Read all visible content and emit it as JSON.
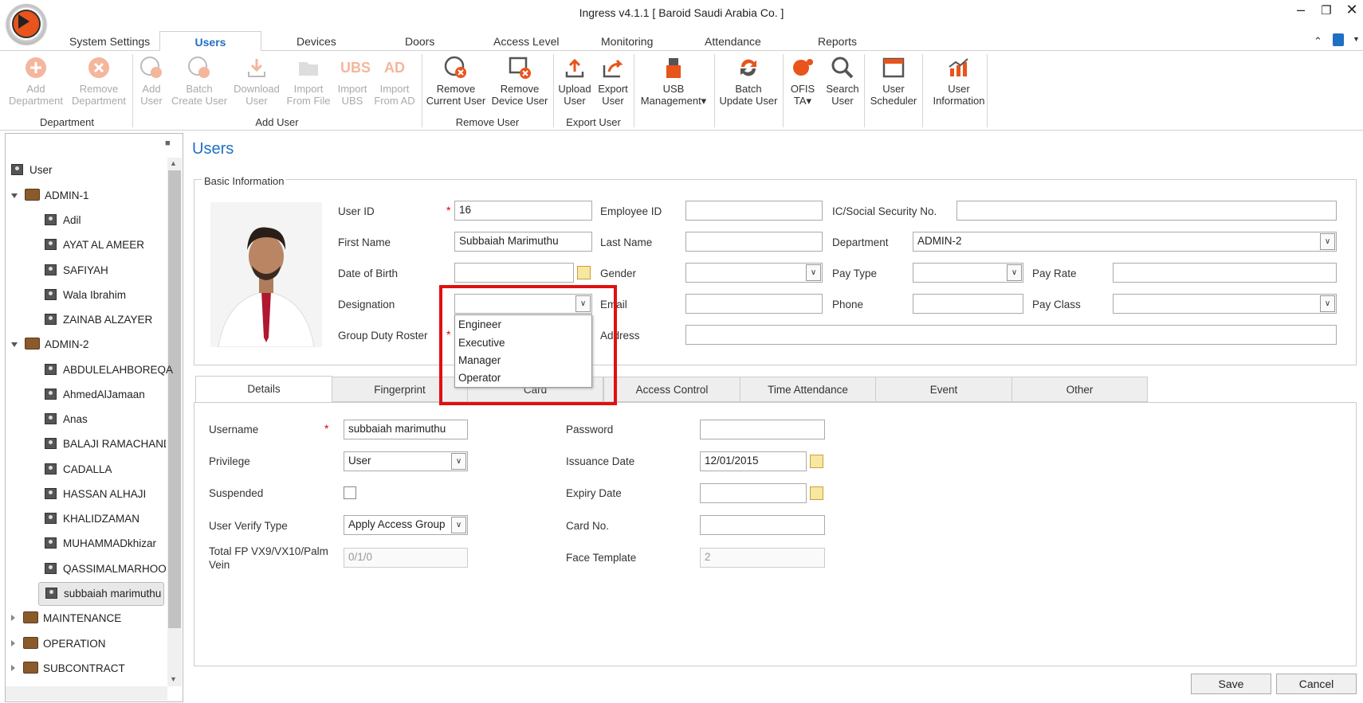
{
  "window": {
    "title": "Ingress v4.1.1 [ Baroid Saudi Arabia Co. ]"
  },
  "ribbon_tabs": [
    "System Settings",
    "Users",
    "Devices",
    "Doors",
    "Access Level",
    "Monitoring",
    "Attendance",
    "Reports"
  ],
  "ribbon": {
    "add_department": [
      "Add",
      "Department"
    ],
    "remove_department": [
      "Remove",
      "Department"
    ],
    "add_user": [
      "Add",
      "User"
    ],
    "batch_create_user": [
      "Batch",
      "Create User"
    ],
    "download_user": [
      "Download",
      "User"
    ],
    "import_from_file": [
      "Import",
      "From File"
    ],
    "import_ubs": [
      "Import",
      "UBS"
    ],
    "import_from_ad": [
      "Import",
      "From AD"
    ],
    "remove_current_user": [
      "Remove",
      "Current User"
    ],
    "remove_device_user": [
      "Remove",
      "Device User"
    ],
    "upload_user": [
      "Upload",
      "User"
    ],
    "export_user": [
      "Export",
      "User"
    ],
    "usb_management": [
      "USB",
      "Management▾"
    ],
    "batch_update_user": [
      "Batch",
      "Update User"
    ],
    "ofis_ta": [
      "OFIS",
      "TA▾"
    ],
    "search_user": [
      "Search",
      "User"
    ],
    "user_scheduler": [
      "User",
      "Scheduler"
    ],
    "user_information": [
      "User",
      "Information"
    ],
    "ubs_text": "UBS",
    "ad_text": "AD",
    "groups": {
      "department": "Department",
      "add_user": "Add User",
      "remove_user": "Remove User",
      "export_user": "Export User"
    }
  },
  "tree": {
    "root": "User",
    "admin1": "ADMIN-1",
    "admin1_users": [
      "Adil",
      "AYAT AL AMEER",
      "SAFIYAH",
      "Wala Ibrahim",
      "ZAINAB  ALZAYER"
    ],
    "admin2": "ADMIN-2",
    "admin2_users": [
      "ABDULELAHBOREQA",
      "AhmedAlJamaan",
      "Anas",
      "BALAJI RAMACHAND",
      "CADALLA",
      "HASSAN ALHAJI",
      "KHALIDZAMAN",
      "MUHAMMADkhizar",
      "QASSIMALMARHOON",
      "subbaiah marimuthu"
    ],
    "groups_rest": [
      "MAINTENANCE",
      "OPERATION",
      "SUBCONTRACT"
    ]
  },
  "main": {
    "title": "Users",
    "basic_info_legend": "Basic Information"
  },
  "basic": {
    "user_id_label": "User ID",
    "user_id": "16",
    "employee_id_label": "Employee ID",
    "ic_label": "IC/Social Security No.",
    "first_name_label": "First Name",
    "first_name": "Subbaiah Marimuthu",
    "last_name_label": "Last Name",
    "department_label": "Department",
    "department": "ADMIN-2",
    "dob_label": "Date of Birth",
    "gender_label": "Gender",
    "pay_type_label": "Pay Type",
    "pay_rate_label": "Pay Rate",
    "designation_label": "Designation",
    "email_label": "Email",
    "phone_label": "Phone",
    "pay_class_label": "Pay Class",
    "group_duty_roster_label": "Group Duty Roster",
    "address_label": "Address",
    "required_mark": "*"
  },
  "designation_options": [
    "Engineer",
    "Executive",
    "Manager",
    "Operator"
  ],
  "detail_tabs": [
    "Details",
    "Fingerprint",
    "Card",
    "Access Control",
    "Time Attendance",
    "Event",
    "Other"
  ],
  "details": {
    "username_label": "Username",
    "username": "subbaiah marimuthu",
    "password_label": "Password",
    "privilege_label": "Privilege",
    "privilege": "User",
    "issuance_date_label": "Issuance Date",
    "issuance_date": "12/01/2015",
    "suspended_label": "Suspended",
    "expiry_date_label": "Expiry Date",
    "verify_type_label": "User Verify Type",
    "verify_type": "Apply Access Group",
    "card_no_label": "Card No.",
    "total_fp_label_1": "Total FP VX9/VX10/Palm",
    "total_fp_label_2": "Vein",
    "total_fp": "0/1/0",
    "face_template_label": "Face Template",
    "face_template": "2"
  },
  "buttons": {
    "save": "Save",
    "cancel": "Cancel"
  },
  "colors": {
    "accent": "#1f6fc4",
    "icon_orange": "#e8541c",
    "highlight": "#e01010"
  }
}
